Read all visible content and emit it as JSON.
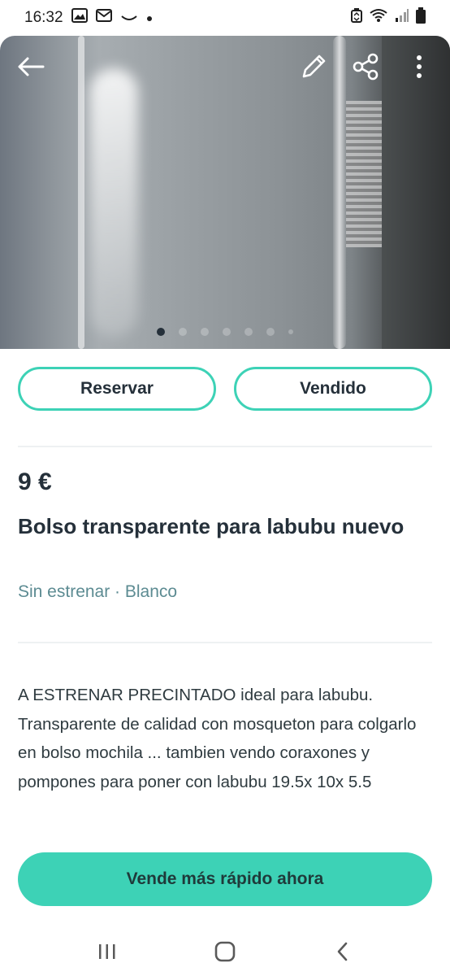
{
  "status_bar": {
    "time": "16:32",
    "left_icons": [
      "image-icon",
      "mail-icon",
      "arc-icon",
      "dot-icon"
    ],
    "right_icons": [
      "recycle-icon",
      "wifi-icon",
      "signal-icon",
      "battery-icon"
    ]
  },
  "hero": {
    "image_description": "transparent-bag-photo",
    "buttons": [
      "back-arrow-icon",
      "pencil-icon",
      "share-icon",
      "more-vertical-icon"
    ],
    "carousel": {
      "total_slides": 7,
      "active_index": 0
    }
  },
  "actions": {
    "reserve_label": "Reservar",
    "sold_label": "Vendido"
  },
  "listing": {
    "price": "9 €",
    "title": "Bolso transparente para labubu nuevo",
    "subtitle": "Sin estrenar · Blanco",
    "description": "A ESTRENAR PRECINTADO ideal para labubu. Transparente de calidad con mosqueton para colgarlo en bolso mochila ... tambien vendo coraxones y pompones para poner con labubu 19.5x 10x 5.5"
  },
  "cta": {
    "label": "Vende más rápido ahora"
  },
  "nav_bar": {
    "buttons": [
      "recent-apps-icon",
      "home-icon",
      "back-icon"
    ]
  },
  "colors": {
    "accent": "#3dd2b6",
    "text_primary": "#25303a",
    "text_secondary": "#5c8b92"
  }
}
